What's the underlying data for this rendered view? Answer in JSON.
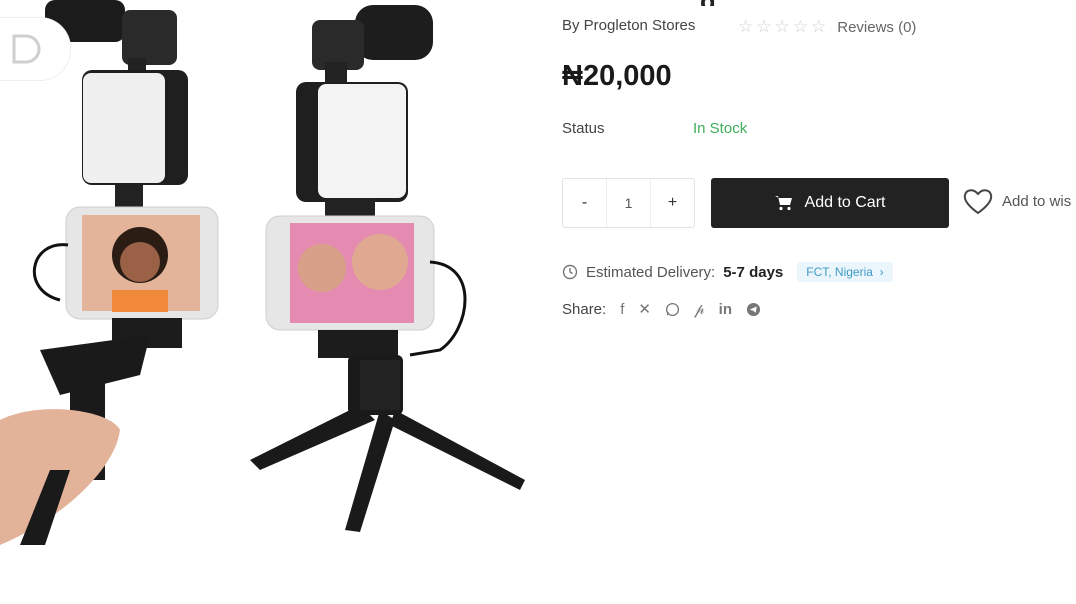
{
  "product": {
    "title_fragment": "g",
    "store": "By Progleton Stores",
    "reviews": "Reviews (0)",
    "price": "₦20,000",
    "status_label": "Status",
    "status_value": "In Stock"
  },
  "cart": {
    "minus": "-",
    "quantity": "1",
    "plus": "+",
    "add_to_cart": "Add to Cart",
    "add_to_wishlist": "Add to wis"
  },
  "delivery": {
    "label": "Estimated Delivery:",
    "days": "5-7 days",
    "location": "FCT, Nigeria"
  },
  "share": {
    "label": "Share:",
    "icons": [
      "facebook-icon",
      "x-icon",
      "whatsapp-icon",
      "pinterest-icon",
      "linkedin-icon",
      "telegram-icon"
    ]
  },
  "colors": {
    "accent_dark": "#222222",
    "in_stock": "#3fae5b",
    "location_bg": "#eaf6fb",
    "location_text": "#3f9bc9"
  }
}
